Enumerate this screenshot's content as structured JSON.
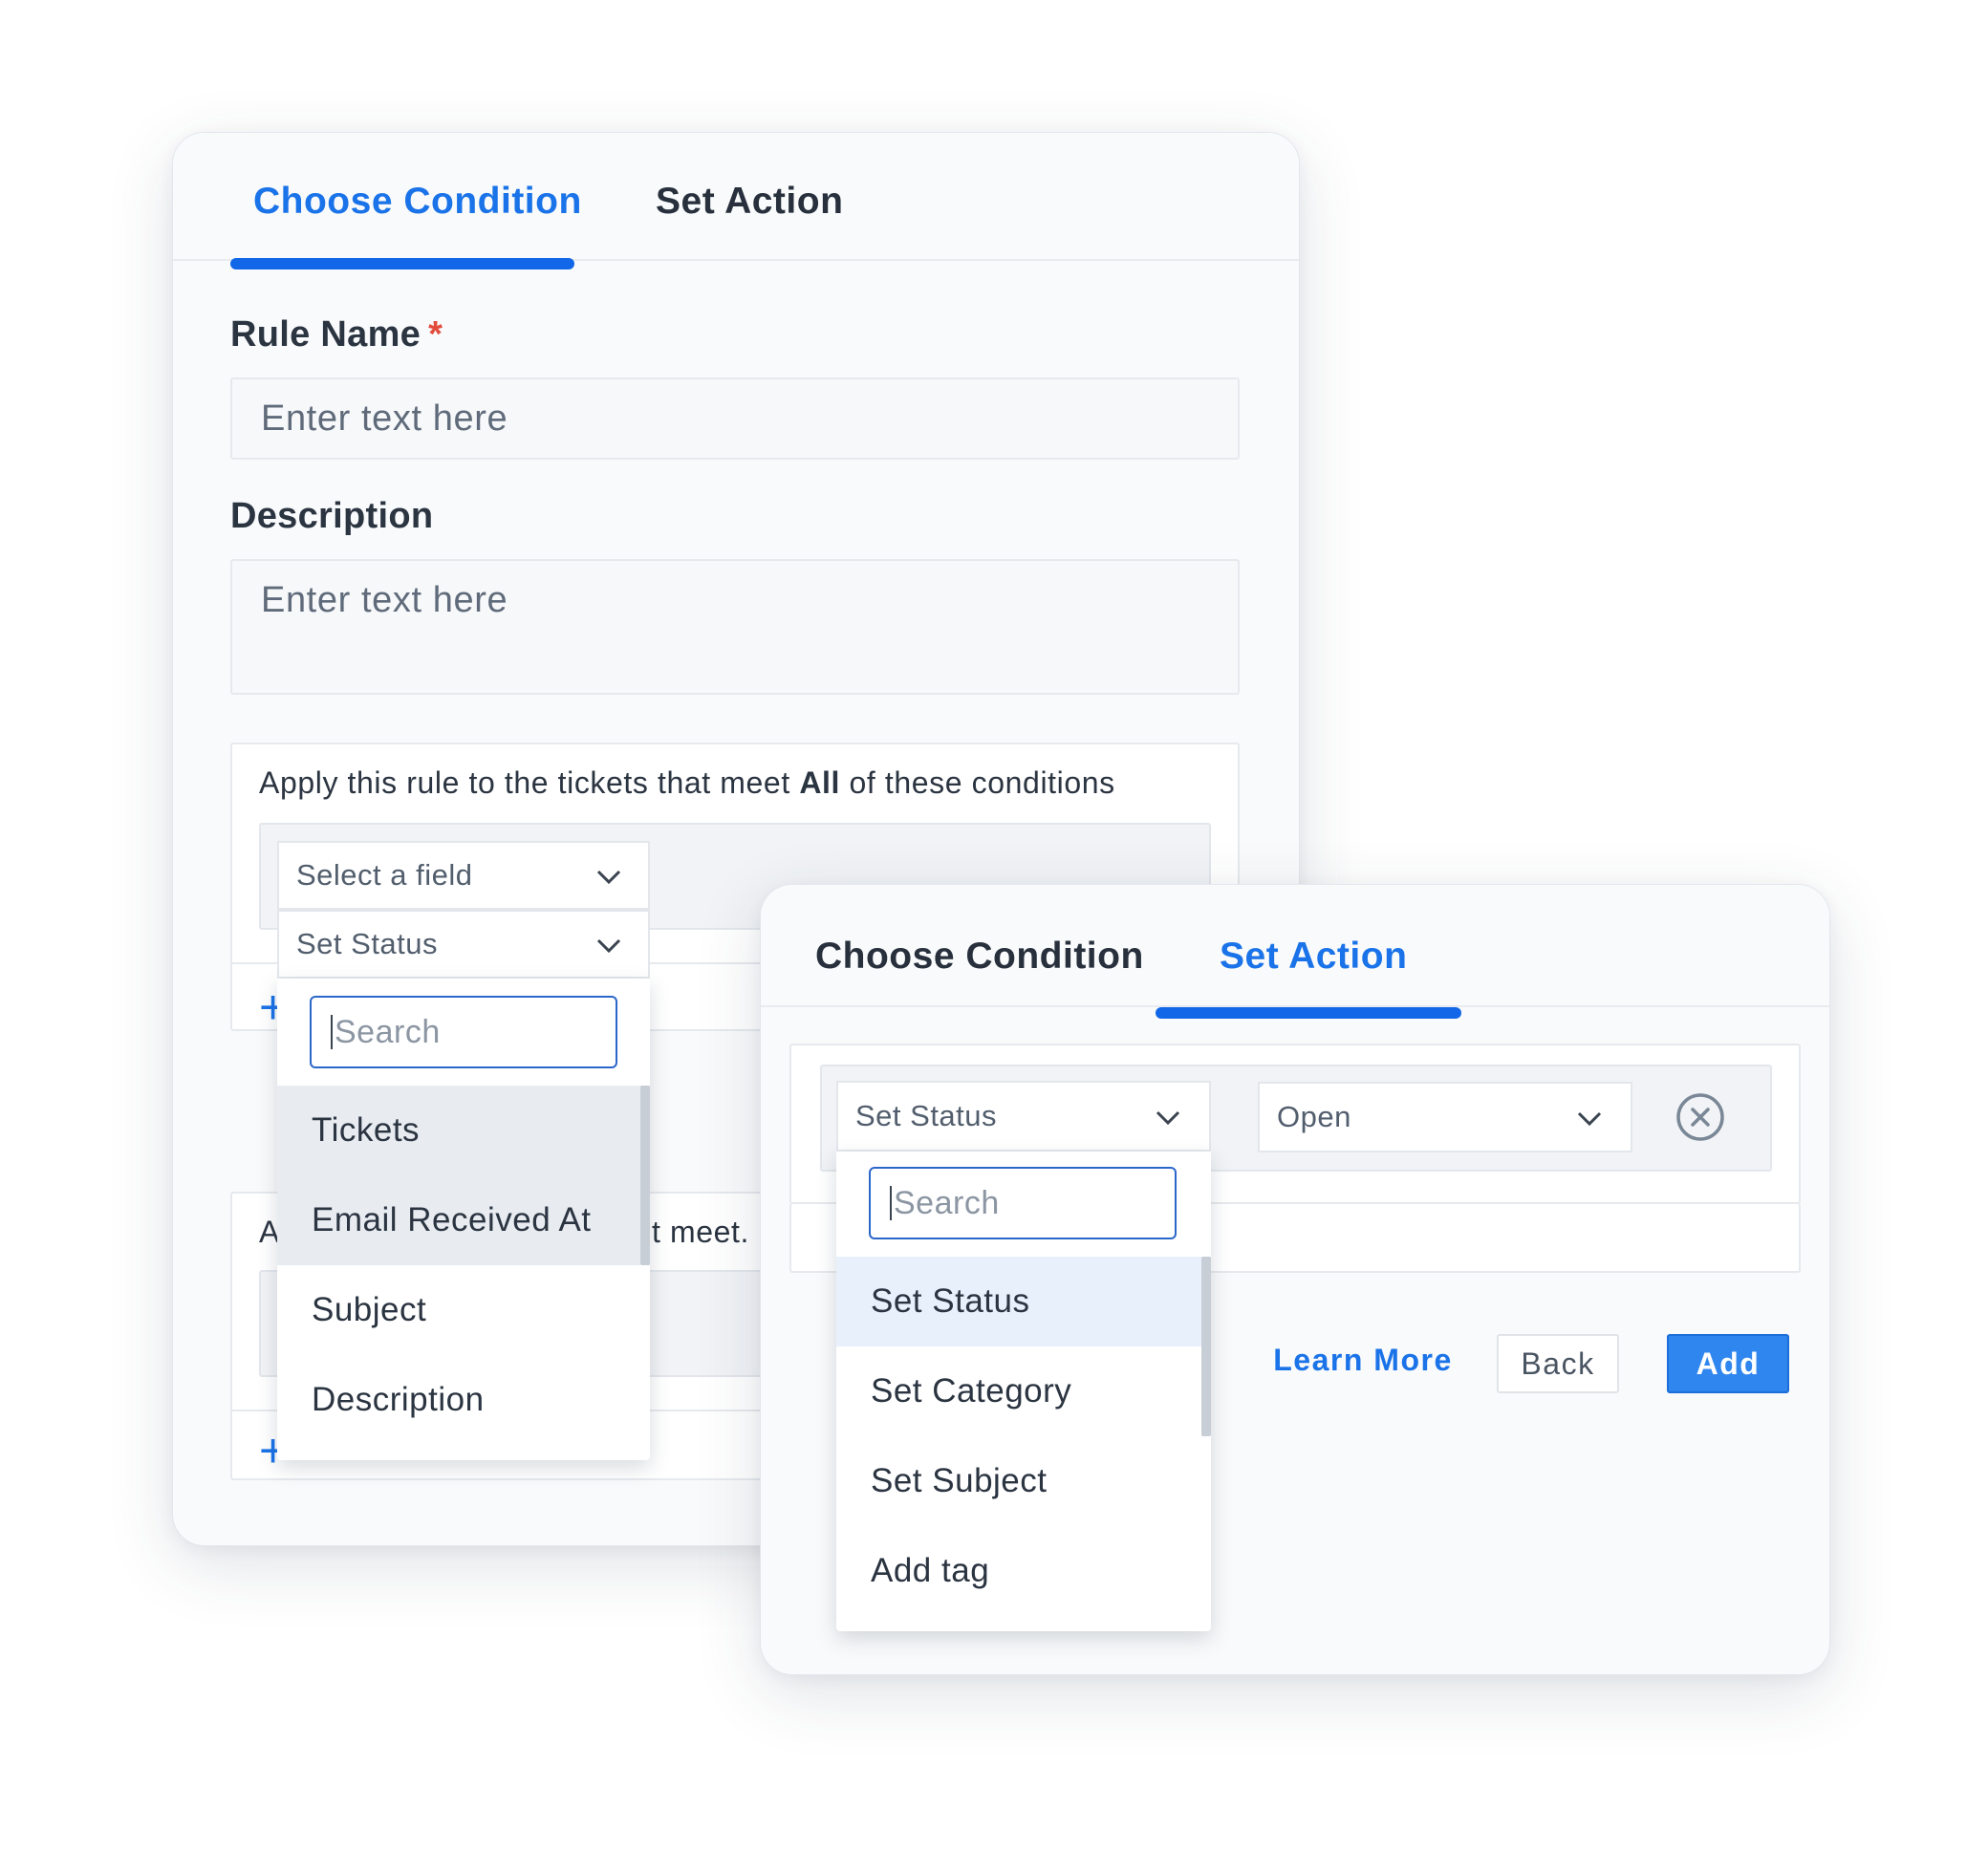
{
  "left_card": {
    "tabs": [
      {
        "label": "Choose Condition",
        "active": true
      },
      {
        "label": "Set Action",
        "active": false
      }
    ],
    "rule_name": {
      "label": "Rule Name",
      "required_mark": "*",
      "placeholder": "Enter text here"
    },
    "description": {
      "label": "Description",
      "placeholder": "Enter text here"
    },
    "conditions": {
      "text_before": "Apply this rule to the tickets that meet ",
      "text_bold": "All",
      "text_after": " of these conditions",
      "field_select": {
        "value": "Select a field"
      },
      "status_select": {
        "value": "Set Status"
      },
      "add_icon": "plus-icon"
    },
    "second_conditions": {
      "text_prefix": "A",
      "text_suffix": "t meet.",
      "add_icon": "plus-icon"
    },
    "dropdown": {
      "search_placeholder": "Search",
      "options": [
        "Tickets",
        "Email Received At",
        "Subject",
        "Description"
      ],
      "highlighted": [
        0,
        1
      ]
    }
  },
  "right_card": {
    "tabs": [
      {
        "label": "Choose Condition",
        "active": false
      },
      {
        "label": "Set Action",
        "active": true
      }
    ],
    "action_select": {
      "value": "Set Status"
    },
    "value_select": {
      "value": "Open"
    },
    "remove_icon": "close-circle-icon",
    "dropdown": {
      "search_placeholder": "Search",
      "options": [
        "Set Status",
        "Set Category",
        "Set Subject",
        "Add tag"
      ],
      "highlighted": [
        0
      ]
    },
    "buttons": {
      "learn_more": "Learn More",
      "back": "Back",
      "add": "Add"
    }
  },
  "colors": {
    "accent": "#1a73e8",
    "underline": "#1167e8",
    "required": "#e34b3c",
    "add_button": "#2f86ef"
  }
}
